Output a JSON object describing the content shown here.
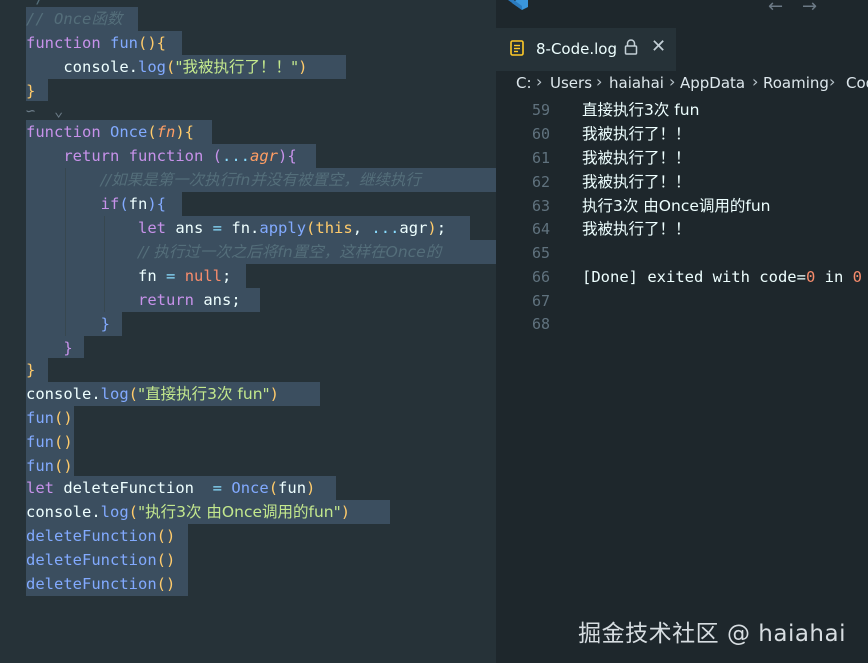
{
  "editor": {
    "comment_once": "// Once函数",
    "kw_function": "function",
    "fn_fun": "fun",
    "paren_brace": "(){",
    "console": "console",
    "dot": ".",
    "log": "log",
    "str_exec": "\"我被执行了！！\"",
    "close_paren": ")",
    "brace_close": "}",
    "fold_marker": "∽",
    "once_name": "Once",
    "fn_param": "fn",
    "kw_return": "return",
    "spread": "...",
    "agr": "agr",
    "comment_first": "//如果是第一次执行fn并没有被置空，继续执行",
    "kw_if": "if",
    "kw_let": "let",
    "ans": "ans",
    "eq": "=",
    "apply": "apply",
    "kw_this": "this",
    "comma": ",",
    "semicolon": ";",
    "comment_after": "// 执行过一次之后将fn置空，这样在Once的",
    "kw_null": "null",
    "str_direct": "\"直接执行3次 fun\"",
    "call_parens": "()",
    "deleteFunction": "deleteFunction",
    "str_once": "\"执行3次 由Once调用的fun\""
  },
  "tab": {
    "label": "8-Code.log",
    "close_glyph": "✕"
  },
  "nav": {
    "back": "←",
    "forward": "→"
  },
  "breadcrumb": [
    "C:",
    "Users",
    "haiahai",
    "AppData",
    "Roaming",
    "Cod"
  ],
  "breadcrumb_sep": "›",
  "output": {
    "line_numbers": [
      "59",
      "60",
      "61",
      "62",
      "63",
      "64",
      "65",
      "66",
      "67",
      "68"
    ],
    "lines": [
      "直接执行3次 fun",
      "我被执行了！！",
      "我被执行了！！",
      "我被执行了！！",
      "执行3次 由Once调用的fun",
      "我被执行了！！",
      "",
      "[Done] exited with code=0 in 0",
      "",
      ""
    ]
  },
  "watermark": "掘金技术社区 @ haiahai",
  "colors": {
    "editor_bg": "#263238",
    "selection": "#3b4e5f",
    "keyword": "#c792ea",
    "function": "#82aaff",
    "string": "#c3e88d",
    "comment": "#546e7a",
    "accent_blue": "#3a96dd"
  }
}
